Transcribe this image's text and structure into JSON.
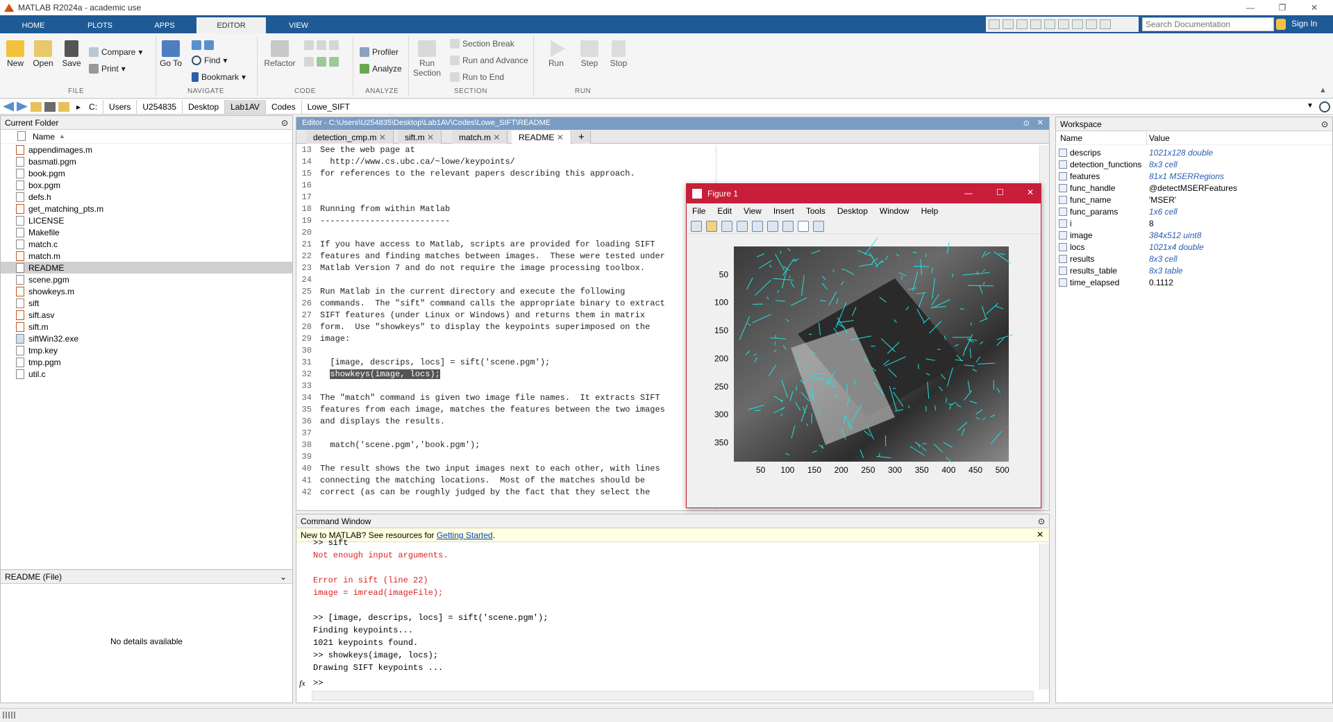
{
  "window": {
    "title": "MATLAB R2024a - academic use"
  },
  "tabs": [
    "HOME",
    "PLOTS",
    "APPS",
    "EDITOR",
    "VIEW"
  ],
  "search": {
    "placeholder": "Search Documentation"
  },
  "signin": "Sign In",
  "ribbon": {
    "file": {
      "new": "New",
      "open": "Open",
      "save": "Save",
      "compare": "Compare",
      "print": "Print",
      "group": "FILE"
    },
    "navigate": {
      "goto": "Go To",
      "find": "Find",
      "bookmark": "Bookmark",
      "group": "NAVIGATE"
    },
    "code": {
      "refactor": "Refactor",
      "group": "CODE"
    },
    "analyze": {
      "profiler": "Profiler",
      "analyze": "Analyze",
      "group": "ANALYZE"
    },
    "section": {
      "run_section": "Run Section",
      "section_break": "Section Break",
      "run_advance": "Run and Advance",
      "run_end": "Run to End",
      "group": "SECTION"
    },
    "run": {
      "run": "Run",
      "step": "Step",
      "stop": "Stop",
      "group": "RUN"
    }
  },
  "path": [
    "C:",
    "Users",
    "U254835",
    "Desktop",
    "Lab1AV",
    "Codes",
    "Lowe_SIFT"
  ],
  "current_folder": {
    "title": "Current Folder",
    "column": "Name",
    "files": [
      "appendimages.m",
      "basmati.pgm",
      "book.pgm",
      "box.pgm",
      "defs.h",
      "get_matching_pts.m",
      "LICENSE",
      "Makefile",
      "match.c",
      "match.m",
      "README",
      "scene.pgm",
      "showkeys.m",
      "sift",
      "sift.asv",
      "sift.m",
      "siftWin32.exe",
      "tmp.key",
      "tmp.pgm",
      "util.c"
    ],
    "selected": "README"
  },
  "details": {
    "title": "README  (File)",
    "empty": "No details available"
  },
  "editor": {
    "title": "Editor - C:\\Users\\U254835\\Desktop\\Lab1AV\\Codes\\Lowe_SIFT\\README",
    "tabs": [
      "detection_cmp.m",
      "sift.m",
      "match.m",
      "README"
    ],
    "active_tab": "README",
    "lines": [
      {
        "n": "13",
        "t": "See the web page at"
      },
      {
        "n": "14",
        "t": "  http://www.cs.ubc.ca/~lowe/keypoints/"
      },
      {
        "n": "15",
        "t": "for references to the relevant papers describing this approach."
      },
      {
        "n": "16",
        "t": ""
      },
      {
        "n": "17",
        "t": ""
      },
      {
        "n": "18",
        "t": "Running from within Matlab"
      },
      {
        "n": "19",
        "t": "--------------------------"
      },
      {
        "n": "20",
        "t": ""
      },
      {
        "n": "21",
        "t": "If you have access to Matlab, scripts are provided for loading SIFT"
      },
      {
        "n": "22",
        "t": "features and finding matches between images.  These were tested under"
      },
      {
        "n": "23",
        "t": "Matlab Version 7 and do not require the image processing toolbox."
      },
      {
        "n": "24",
        "t": ""
      },
      {
        "n": "25",
        "t": "Run Matlab in the current directory and execute the following"
      },
      {
        "n": "26",
        "t": "commands.  The \"sift\" command calls the appropriate binary to extract"
      },
      {
        "n": "27",
        "t": "SIFT features (under Linux or Windows) and returns them in matrix"
      },
      {
        "n": "28",
        "t": "form.  Use \"showkeys\" to display the keypoints superimposed on the"
      },
      {
        "n": "29",
        "t": "image:"
      },
      {
        "n": "30",
        "t": ""
      },
      {
        "n": "31",
        "t": "  [image, descrips, locs] = sift('scene.pgm');"
      },
      {
        "n": "32",
        "t": "  showkeys(image, locs);"
      },
      {
        "n": "33",
        "t": ""
      },
      {
        "n": "34",
        "t": "The \"match\" command is given two image file names.  It extracts SIFT"
      },
      {
        "n": "35",
        "t": "features from each image, matches the features between the two images"
      },
      {
        "n": "36",
        "t": "and displays the results."
      },
      {
        "n": "37",
        "t": ""
      },
      {
        "n": "38",
        "t": "  match('scene.pgm','book.pgm');"
      },
      {
        "n": "39",
        "t": ""
      },
      {
        "n": "40",
        "t": "The result shows the two input images next to each other, with lines"
      },
      {
        "n": "41",
        "t": "connecting the matching locations.  Most of the matches should be"
      },
      {
        "n": "42",
        "t": "correct (as can be roughly judged by the fact that they select the"
      }
    ],
    "highlight_line": "32"
  },
  "figure": {
    "title": "Figure 1",
    "menu": [
      "File",
      "Edit",
      "View",
      "Insert",
      "Tools",
      "Desktop",
      "Window",
      "Help"
    ],
    "yticks": [
      "50",
      "100",
      "150",
      "200",
      "250",
      "300",
      "350"
    ],
    "xticks": [
      "50",
      "100",
      "150",
      "200",
      "250",
      "300",
      "350",
      "400",
      "450",
      "500"
    ]
  },
  "command_window": {
    "title": "Command Window",
    "banner": "New to MATLAB? See resources for ",
    "banner_link": "Getting Started",
    "banner_end": ".",
    "lines": [
      {
        "t": ">> sift",
        "c": ""
      },
      {
        "t": "Not enough input arguments.",
        "c": "err"
      },
      {
        "t": "",
        "c": ""
      },
      {
        "t": "Error in sift (line 22)",
        "c": "err"
      },
      {
        "t": "image = imread(imageFile);",
        "c": "err"
      },
      {
        "t": "",
        "c": ""
      },
      {
        "t": ">> [image, descrips, locs] = sift('scene.pgm');",
        "c": ""
      },
      {
        "t": "Finding keypoints...",
        "c": ""
      },
      {
        "t": "1021 keypoints found.",
        "c": ""
      },
      {
        "t": ">> showkeys(image, locs);",
        "c": ""
      },
      {
        "t": "Drawing SIFT keypoints ...",
        "c": ""
      }
    ],
    "prompt": ">>",
    "fx": "fx"
  },
  "workspace": {
    "title": "Workspace",
    "col_name": "Name",
    "col_value": "Value",
    "vars": [
      {
        "name": "descrips",
        "value": "1021x128 double",
        "italic": true
      },
      {
        "name": "detection_functions",
        "value": "8x3 cell",
        "italic": true
      },
      {
        "name": "features",
        "value": "81x1 MSERRegions",
        "italic": true
      },
      {
        "name": "func_handle",
        "value": "@detectMSERFeatures",
        "italic": false
      },
      {
        "name": "func_name",
        "value": "'MSER'",
        "italic": false
      },
      {
        "name": "func_params",
        "value": "1x6 cell",
        "italic": true
      },
      {
        "name": "i",
        "value": "8",
        "italic": false
      },
      {
        "name": "image",
        "value": "384x512 uint8",
        "italic": true
      },
      {
        "name": "locs",
        "value": "1021x4 double",
        "italic": true
      },
      {
        "name": "results",
        "value": "8x3 cell",
        "italic": true
      },
      {
        "name": "results_table",
        "value": "8x3 table",
        "italic": true
      },
      {
        "name": "time_elapsed",
        "value": "0.1112",
        "italic": false
      }
    ]
  }
}
